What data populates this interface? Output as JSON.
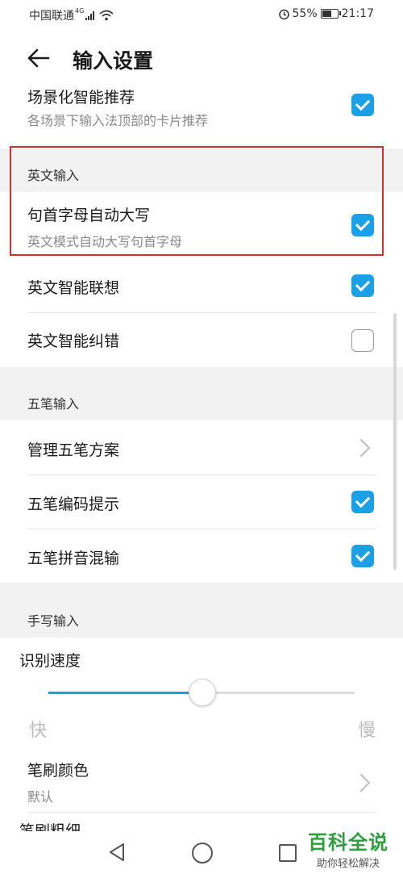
{
  "status_bar": {
    "carrier": "中国联通",
    "network": "4G",
    "battery": "55%",
    "time": "21:17"
  },
  "header": {
    "title": "输入设置"
  },
  "rows": {
    "scene": {
      "title": "场景化智能推荐",
      "subtitle": "各场景下输入法顶部的卡片推荐",
      "checked": true
    },
    "caps": {
      "title": "句首字母自动大写",
      "subtitle": "英文模式自动大写句首字母",
      "checked": true
    },
    "en_predict": {
      "title": "英文智能联想",
      "checked": true
    },
    "en_correct": {
      "title": "英文智能纠错",
      "checked": false
    },
    "wubi_manage": {
      "title": "管理五笔方案"
    },
    "wubi_hint": {
      "title": "五笔编码提示",
      "checked": true
    },
    "wubi_mix": {
      "title": "五笔拼音混输",
      "checked": true
    },
    "brush_color": {
      "title": "笔刷颜色",
      "value": "默认"
    },
    "brush_width": {
      "title": "笔刷粗细"
    }
  },
  "sections": {
    "english": "英文输入",
    "wubi": "五笔输入",
    "handwriting": "手写输入"
  },
  "recognition_speed": {
    "label": "识别速度",
    "min_label": "快",
    "max_label": "慢",
    "level": 0.5
  },
  "watermark": {
    "main": "百科全说",
    "sub": "助你轻松解决"
  },
  "colors": {
    "accent": "#1aa0e6",
    "highlight": "#d32f2f"
  },
  "icons": {
    "back": "arrow-left-icon",
    "wifi": "wifi-icon",
    "alarm": "alarm-icon",
    "battery": "battery-icon",
    "nav_back": "triangle-back-icon",
    "nav_home": "circle-home-icon",
    "nav_recent": "square-recent-icon"
  }
}
